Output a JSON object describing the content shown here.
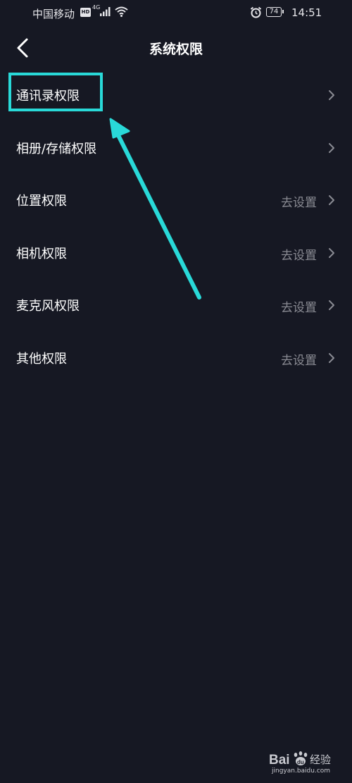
{
  "status_bar": {
    "carrier": "中国移动",
    "hd_badge": "HD",
    "network_type": "4G",
    "battery_level": "74",
    "time": "14:51",
    "icons": [
      "hd-icon",
      "signal-icon",
      "wifi-icon",
      "alarm-icon",
      "battery-icon"
    ]
  },
  "header": {
    "back_icon": "chevron-left-icon",
    "title": "系统权限"
  },
  "permissions": [
    {
      "label": "通讯录权限",
      "action": ""
    },
    {
      "label": "相册/存储权限",
      "action": ""
    },
    {
      "label": "位置权限",
      "action": "去设置"
    },
    {
      "label": "相机权限",
      "action": "去设置"
    },
    {
      "label": "麦克风权限",
      "action": "去设置"
    },
    {
      "label": "其他权限",
      "action": "去设置"
    }
  ],
  "annotation": {
    "color": "#29d9d8",
    "highlighted_item": "通讯录权限"
  },
  "watermark": {
    "brand": "Bai du 经验",
    "caption": "jingyan.baidu.com"
  },
  "colors": {
    "background": "#161823",
    "text": "#ffffff",
    "secondary_text": "#8a8b93",
    "chevron": "#8a8b93",
    "annotation": "#29d9d8"
  }
}
